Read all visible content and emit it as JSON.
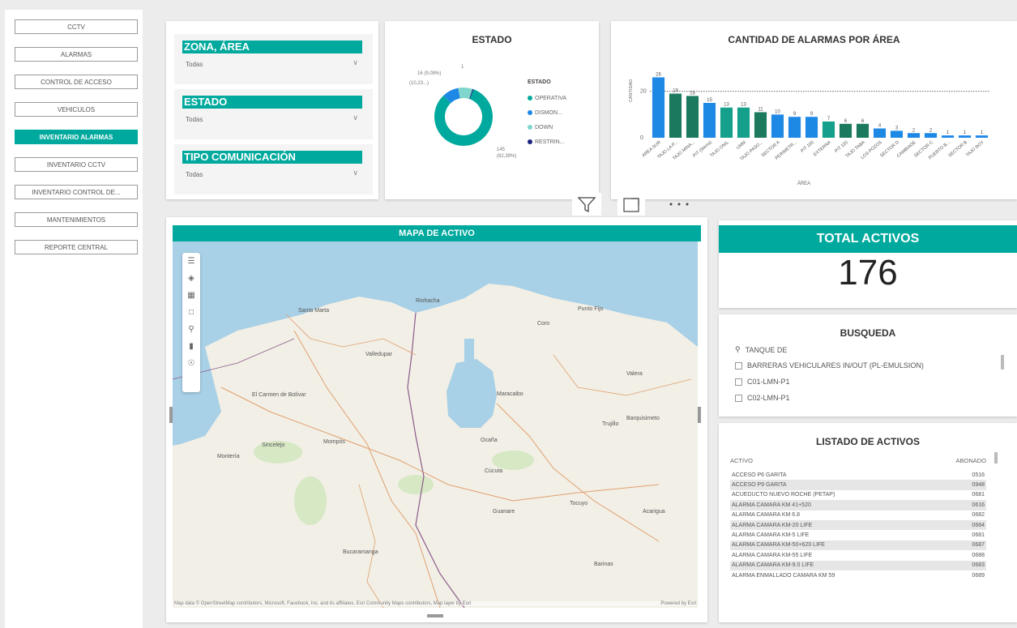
{
  "nav": [
    {
      "label": "CCTV",
      "active": false
    },
    {
      "label": "ALARMAS",
      "active": false
    },
    {
      "label": "CONTROL DE ACCESO",
      "active": false
    },
    {
      "label": "VEHICULOS",
      "active": false
    },
    {
      "label": "INVENTARIO ALARMAS",
      "active": true
    },
    {
      "label": "INVENTARIO CCTV",
      "active": false
    },
    {
      "label": "INVENTARIO CONTROL DE...",
      "active": false
    },
    {
      "label": "MANTENIMIENTOS",
      "active": false
    },
    {
      "label": "REPORTE CENTRAL",
      "active": false
    }
  ],
  "filters": [
    {
      "title": "ZONA, ÁREA",
      "value": "Todas"
    },
    {
      "title": "ESTADO",
      "value": "Todas"
    },
    {
      "title": "TIPO COMUNICACIÓN",
      "value": "Todas"
    }
  ],
  "estado": {
    "title": "ESTADO",
    "legend_title": "ESTADO",
    "labels": {
      "operativa": "145\n(82,39%)",
      "dismon": "16 (9,09%)",
      "down": "(10,23...)",
      "restrin": "1"
    },
    "colors": {
      "operativa": "#00a99d",
      "dismon": "#1e88e5",
      "down": "#7fd6cc",
      "restrin": "#1a237e"
    }
  },
  "chart_data": [
    {
      "type": "pie",
      "title": "ESTADO",
      "categories": [
        "OPERATIVA",
        "DISMON...",
        "DOWN",
        "RESTRIN..."
      ],
      "values": [
        145,
        16,
        14,
        1
      ],
      "legend": "right"
    },
    {
      "type": "bar",
      "title": "CANTIDAD DE ALARMAS POR ÁREA",
      "xlabel": "ÁREA",
      "ylabel": "CANTIDAD",
      "categories": [
        "AREA SUR",
        "TAJO LA P...",
        "TAJO MINA...",
        "PIT (Sierra)",
        "TAJO ONIL",
        "UMM",
        "TAJO PASO...",
        "SECTOR A",
        "PERIMETR...",
        "PIT 100",
        "EXTERNA",
        "PIT 120",
        "TAJO TABA",
        "LOS POZOS",
        "SECTOR D",
        "CAMBIADE",
        "SECTOR C",
        "PUERTO B...",
        "SECTOR B",
        "TAJO ROY"
      ],
      "values": [
        26,
        19,
        18,
        15,
        13,
        13,
        11,
        10,
        9,
        9,
        7,
        6,
        6,
        4,
        3,
        2,
        2,
        1,
        1,
        1
      ],
      "ylim": [
        0,
        30
      ],
      "yticks": [
        "0",
        "20"
      ],
      "reference_line": 20
    }
  ],
  "bar_chart": {
    "title": "CANTIDAD DE ALARMAS POR ÁREA",
    "colors": [
      "#1e88e5",
      "#1b7a5e",
      "#1b7a5e",
      "#1e88e5",
      "#14a08a",
      "#14a08a",
      "#1b7a5e",
      "#1e88e5",
      "#1e88e5",
      "#1e88e5",
      "#14a08a",
      "#1b7a5e",
      "#1b7a5e",
      "#1e88e5",
      "#1e88e5",
      "#1e88e5",
      "#1e88e5",
      "#1e88e5",
      "#1e88e5",
      "#1e88e5"
    ]
  },
  "map": {
    "title": "MAPA DE ACTIVO",
    "labels": [
      "Santa Marta",
      "Riohacha",
      "Valledupar",
      "El Carmen de Bolívar",
      "Maracaibo",
      "Barquisimeto",
      "Coro",
      "Punto Fijo",
      "Montería",
      "Sincelejo",
      "Mompós",
      "Ocaña",
      "Cúcuta",
      "Bucaramanga",
      "Trujillo",
      "Barinas",
      "Valera",
      "Tocuyo",
      "Guanare",
      "Acarigua"
    ],
    "attribution": "Map data © OpenStreetMap contributors, Microsoft, Facebook, Inc. and its affiliates, Esri Community Maps contributors, Map layer by Esri",
    "powered": "Powered by Esri"
  },
  "total": {
    "title": "TOTAL ACTIVOS",
    "value": "176"
  },
  "busqueda": {
    "title": "BUSQUEDA",
    "query": "TANQUE DE",
    "options": [
      "BARRERAS VEHICULARES IN/OUT (PL-EMULSION)",
      "C01-LMN-P1",
      "C02-LMN-P1"
    ]
  },
  "listado": {
    "title": "LISTADO DE ACTIVOS",
    "columns": [
      "ACTIVO",
      "ABONADO"
    ],
    "rows": [
      [
        "ACCESO P6 GARITA",
        "0516"
      ],
      [
        "ACCESO P9 GARITA",
        "0948"
      ],
      [
        "ACUEDUCTO NUEVO ROCHE (PETAP)",
        "0681"
      ],
      [
        "ALARMA CAMARA KM 41+520",
        "0616"
      ],
      [
        "ALARMA CAMARA KM 6.8",
        "0682"
      ],
      [
        "ALARMA CAMARA KM-20 LIFE",
        "0684"
      ],
      [
        "ALARMA CAMARA KM-5 LIFE",
        "0681"
      ],
      [
        "ALARMA CAMARA KM-50+620 LIFE",
        "0687"
      ],
      [
        "ALARMA CAMARA KM-55 LIFE",
        "0688"
      ],
      [
        "ALARMA CAMARA KM-9.0 LIFE",
        "0683"
      ],
      [
        "ALARMA ENMALLADO CAMARA KM 59",
        "0689"
      ]
    ]
  }
}
